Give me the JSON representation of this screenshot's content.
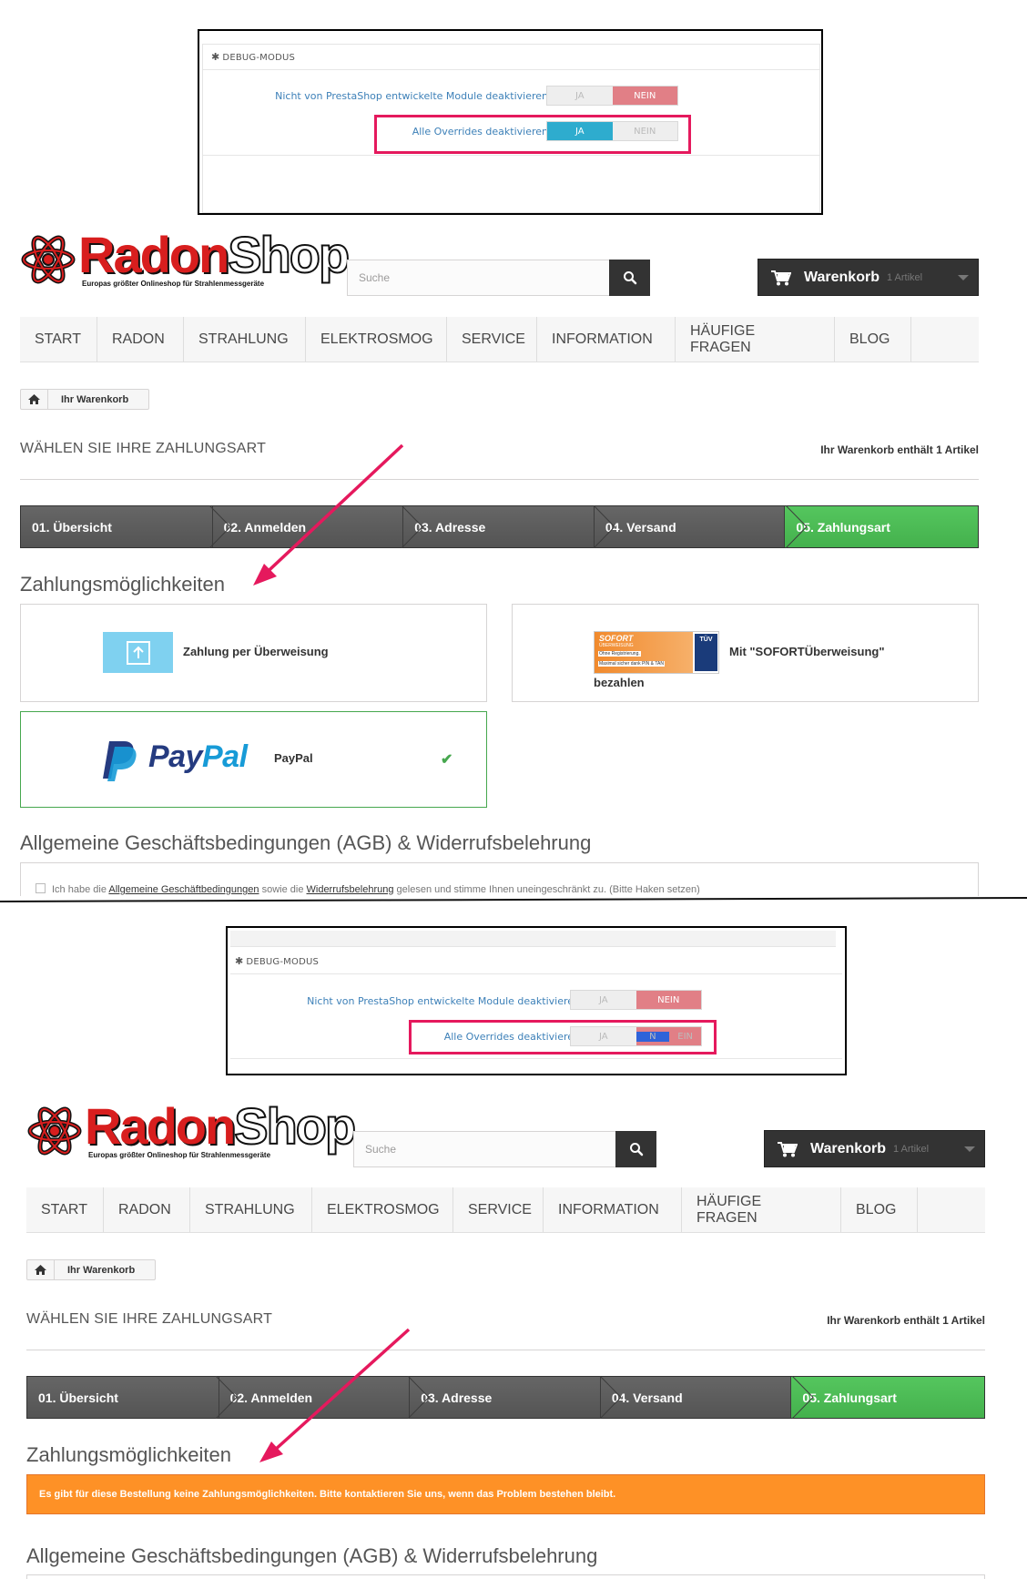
{
  "debug_panels": [
    {
      "heading": "DEBUG-MODUS",
      "rows": [
        {
          "label": "Nicht von PrestaShop entwickelte Module deaktivieren",
          "yes": "JA",
          "no": "NEIN",
          "value": "NEIN"
        },
        {
          "label": "Alle Overrides deaktivieren",
          "yes": "JA",
          "no": "NEIN",
          "value": "JA"
        }
      ]
    },
    {
      "heading": "DEBUG-MODUS",
      "rows": [
        {
          "label": "Nicht von PrestaShop entwickelte Module deaktivieren",
          "yes": "JA",
          "no": "NEIN",
          "value": "NEIN"
        },
        {
          "label": "Alle Overrides deaktivieren",
          "yes": "JA",
          "no_a": "N",
          "no_b": "EIN",
          "value": "NEIN"
        }
      ]
    }
  ],
  "shop": {
    "logo_radon": "Radon",
    "logo_shop": "Shop",
    "logo_tagline": "Europas größter Onlineshop für Strahlenmessgeräte",
    "search_placeholder": "Suche",
    "cart_label": "Warenkorb",
    "cart_count": "1 Artikel",
    "menu": [
      "START",
      "RADON",
      "STRAHLUNG",
      "ELEKTROSMOG",
      "SERVICE",
      "INFORMATION",
      "HÄUFIGE FRAGEN",
      "BLOG"
    ],
    "breadcrumb": "Ihr Warenkorb",
    "page_heading": "WÄHLEN SIE IHRE ZAHLUNGSART",
    "heading_counter": "Ihr Warenkorb enthält 1 Artikel",
    "steps": [
      "01. Übersicht",
      "02. Anmelden",
      "03. Adresse",
      "04. Versand",
      "05. Zahlungsart"
    ],
    "payment_title": "Zahlungsmöglichkeiten",
    "payments": {
      "bankwire": "Zahlung per Überweisung",
      "sofort_a": "Mit \"SOFORTÜberweisung\"",
      "sofort_b": "bezahlen",
      "sofort_logo_title": "SOFORT",
      "sofort_logo_sub": "ÜBERWEISUNG",
      "sofort_logo_line1": "Ohne Registrierung.",
      "sofort_logo_line2": "Maximal sicher dank PIN & TAN",
      "sofort_tuv": "TÜV",
      "paypal_logo_pay": "Pay",
      "paypal_logo_pal": "Pal",
      "paypal": "PayPal"
    },
    "no_payment_alert": "Es gibt für diese Bestellung keine Zahlungsmöglichkeiten. Bitte kontaktieren Sie uns, wenn das Problem bestehen bleibt.",
    "agb_title": "Allgemeine Geschäftsbedingungen (AGB) & Widerrufsbelehrung",
    "agb_text_1": "Ich habe die ",
    "agb_link_1": "Allgemeine Geschäftbedingungen",
    "agb_text_2": " sowie die ",
    "agb_link_2": "Widerrufsbelehrung",
    "agb_text_3": " gelesen und stimme Ihnen uneingeschränkt zu. (Bitte Haken setzen)"
  },
  "colors": {
    "active_step": "#4cbb55",
    "annotation": "#e5195d",
    "alert": "#fe9126",
    "switch_yes": "#2eacce",
    "switch_no": "#e17f86"
  }
}
